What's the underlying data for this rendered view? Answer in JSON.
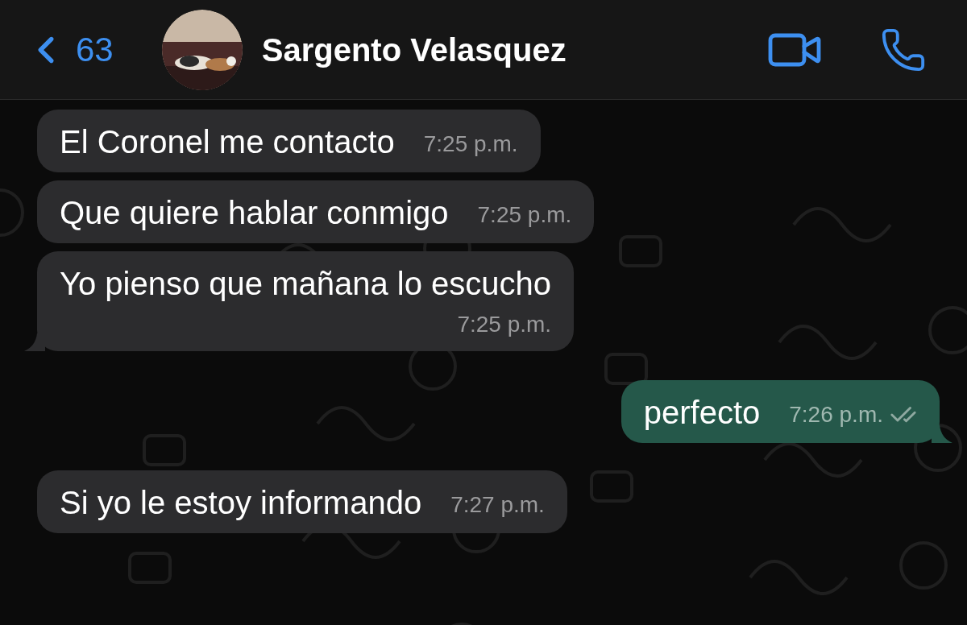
{
  "header": {
    "back_count": "63",
    "contact_name": "Sargento Velasquez"
  },
  "messages": [
    {
      "kind": "incoming",
      "text": "El Coronel me contacto",
      "time": "7:25 p.m.",
      "time_below": false,
      "tail": false
    },
    {
      "kind": "incoming",
      "text": "Que quiere hablar conmigo",
      "time": "7:25 p.m.",
      "time_below": false,
      "tail": false
    },
    {
      "kind": "incoming",
      "text": "Yo pienso que mañana lo escucho",
      "time": "7:25 p.m.",
      "time_below": true,
      "tail": true
    },
    {
      "kind": "outgoing",
      "text": "perfecto",
      "time": "7:26 p.m.",
      "time_below": false,
      "tail": true,
      "read": false
    },
    {
      "kind": "incoming",
      "text": "Si yo le estoy informando",
      "time": "7:27 p.m.",
      "time_below": false,
      "tail": false
    }
  ]
}
